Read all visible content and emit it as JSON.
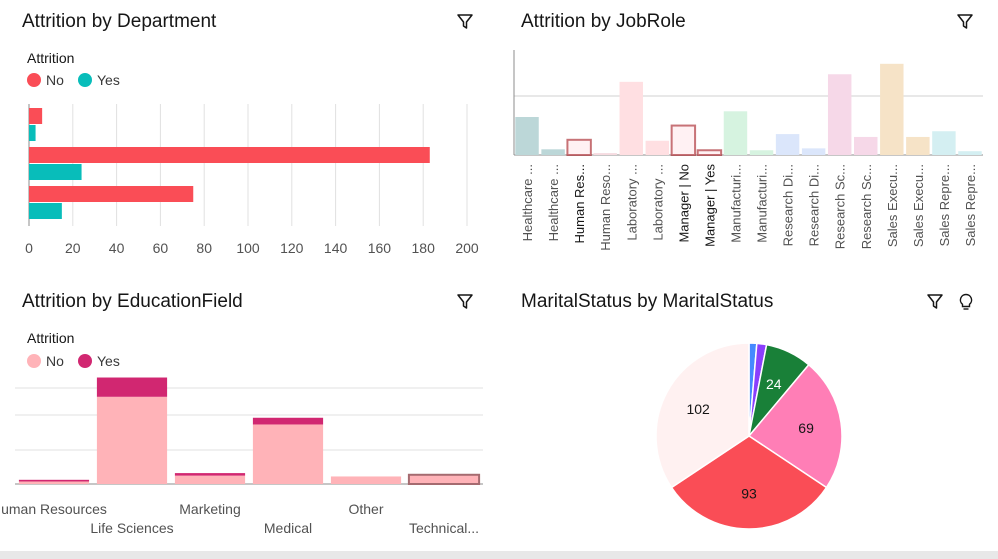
{
  "panels": {
    "department": {
      "title": "Attrition by Department"
    },
    "jobrole": {
      "title": "Attrition by JobRole"
    },
    "education": {
      "title": "Attrition by EducationField"
    },
    "marital": {
      "title": "MaritalStatus by MaritalStatus"
    }
  },
  "colors": {
    "no_red": "#fa4d56",
    "yes_teal": "#08bdba",
    "no_pink": "#ffb3b8",
    "yes_magenta": "#d12771"
  },
  "icons": {
    "filter": "filter-icon",
    "insight": "lightbulb-icon"
  },
  "chart_data": [
    {
      "type": "bar",
      "orientation": "horizontal",
      "legend_title": "Attrition",
      "legend": [
        "No",
        "Yes"
      ],
      "legend_placement": "top-left",
      "series": [
        {
          "name": "No",
          "values": [
            6,
            183,
            75
          ]
        },
        {
          "name": "Yes",
          "values": [
            3,
            24,
            15
          ]
        }
      ],
      "xlim": [
        0,
        200
      ],
      "xticks": [
        "0",
        "20",
        "40",
        "60",
        "80",
        "100",
        "120",
        "140",
        "160",
        "180",
        "200"
      ],
      "grid": true
    },
    {
      "type": "bar",
      "categories": [
        "Healthcare ...",
        "Healthcare ...",
        "Human Res...",
        "Human Reso...",
        "Laboratory ...",
        "Laboratory ...",
        "Manager | No",
        "Manager | Yes",
        "Manufacturi...",
        "Manufacturi...",
        "Research Di...",
        "Research Di...",
        "Research Sc...",
        "Research Sc...",
        "Sales Execu...",
        "Sales Execu...",
        "Sales Repre...",
        "Sales Repre..."
      ],
      "values": [
        40,
        6,
        16,
        2,
        77,
        15,
        31,
        5,
        46,
        5,
        22,
        7,
        85,
        19,
        96,
        19,
        25,
        4
      ],
      "ylim": [
        0,
        100
      ],
      "grid": true,
      "highlighted": [
        "Human Res...",
        "Manager | No",
        "Manager | Yes"
      ]
    },
    {
      "type": "bar",
      "stacked": true,
      "legend_title": "Attrition",
      "legend": [
        "No",
        "Yes"
      ],
      "legend_placement": "top-left",
      "categories": [
        "uman Resources",
        "Life Sciences",
        "Marketing",
        "Medical",
        "Other",
        "Technical..."
      ],
      "series": [
        {
          "name": "No",
          "values": [
            3,
            104,
            10,
            71,
            9,
            11
          ]
        },
        {
          "name": "Yes",
          "values": [
            2,
            23,
            3,
            8,
            0,
            0
          ]
        }
      ],
      "ylim": [
        0,
        130
      ],
      "grid": true
    },
    {
      "type": "pie",
      "labels_shown": [
        "102",
        "93",
        "69",
        "24"
      ],
      "slices": [
        {
          "value": 4,
          "label": "",
          "color": "#4589ff"
        },
        {
          "value": 5,
          "label": "",
          "color": "#8a3ffc"
        },
        {
          "value": 24,
          "label": "24",
          "color": "#198038"
        },
        {
          "value": 69,
          "label": "69",
          "color": "#ff7eb6"
        },
        {
          "value": 93,
          "label": "93",
          "color": "#fa4d56"
        },
        {
          "value": 102,
          "label": "102",
          "color": "#fff1f1"
        }
      ]
    }
  ]
}
